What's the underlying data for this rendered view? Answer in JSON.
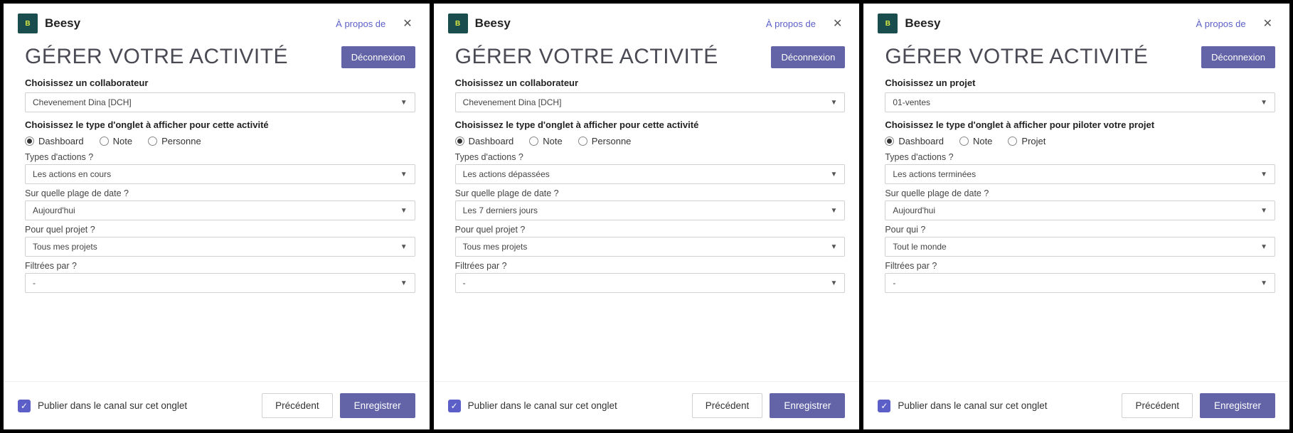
{
  "app_name": "Beesy",
  "about_label": "À propos de",
  "logout_label": "Déconnexion",
  "publish_label": "Publier dans le canal sur cet onglet",
  "prev_label": "Précédent",
  "save_label": "Enregistrer",
  "panels": [
    {
      "title": "GÉRER VOTRE ACTIVITÉ",
      "choose_label": "Choisissez un collaborateur",
      "choose_value": "Chevenement Dina [DCH]",
      "tab_type_label": "Choisissez le type d'onglet à afficher pour cette activité",
      "radios": [
        "Dashboard",
        "Note",
        "Personne"
      ],
      "radio_selected": 0,
      "fields": [
        {
          "label": "Types d'actions ?",
          "value": "Les actions en cours"
        },
        {
          "label": "Sur quelle plage de date ?",
          "value": "Aujourd'hui"
        },
        {
          "label": "Pour quel projet ?",
          "value": "Tous mes projets"
        },
        {
          "label": "Filtrées par ?",
          "value": "-"
        }
      ]
    },
    {
      "title": "GÉRER VOTRE ACTIVITÉ",
      "choose_label": "Choisissez un collaborateur",
      "choose_value": "Chevenement Dina [DCH]",
      "tab_type_label": "Choisissez le type d'onglet à afficher pour cette activité",
      "radios": [
        "Dashboard",
        "Note",
        "Personne"
      ],
      "radio_selected": 0,
      "fields": [
        {
          "label": "Types d'actions ?",
          "value": "Les actions dépassées"
        },
        {
          "label": "Sur quelle plage de date ?",
          "value": "Les 7 derniers jours"
        },
        {
          "label": "Pour quel projet ?",
          "value": "Tous mes projets"
        },
        {
          "label": "Filtrées par ?",
          "value": "-"
        }
      ]
    },
    {
      "title": "GÉRER VOTRE ACTIVITÉ",
      "choose_label": "Choisissez un projet",
      "choose_value": "01-ventes",
      "tab_type_label": "Choisissez le type d'onglet à afficher pour piloter votre projet",
      "radios": [
        "Dashboard",
        "Note",
        "Projet"
      ],
      "radio_selected": 0,
      "fields": [
        {
          "label": "Types d'actions ?",
          "value": "Les actions terminées"
        },
        {
          "label": "Sur quelle plage de date ?",
          "value": "Aujourd'hui"
        },
        {
          "label": "Pour qui ?",
          "value": "Tout le monde"
        },
        {
          "label": "Filtrées par ?",
          "value": "-"
        }
      ]
    }
  ]
}
